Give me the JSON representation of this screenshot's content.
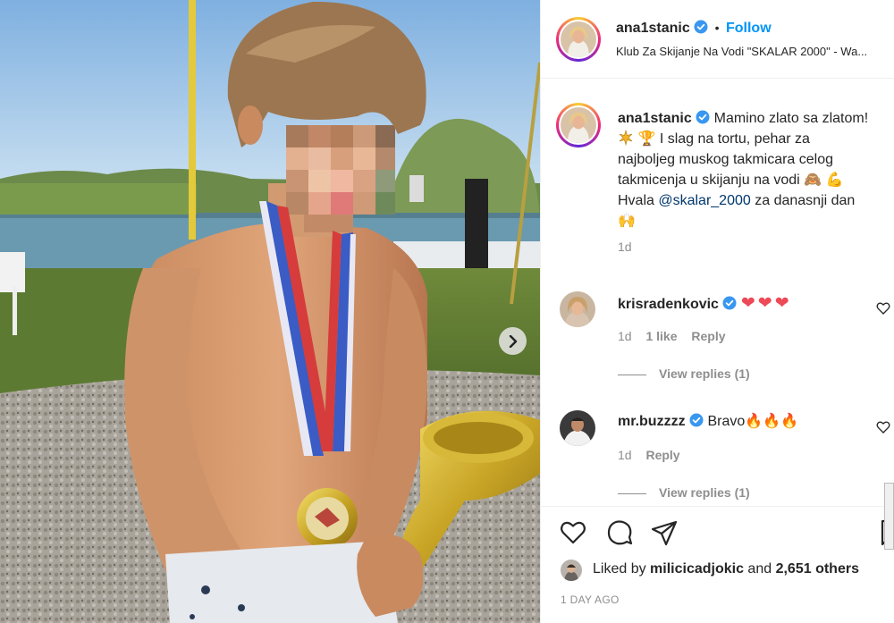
{
  "post": {
    "username": "ana1stanic",
    "follow_label": "Follow",
    "separator": "•",
    "location": "Klub Za Skijanje Na Vodi \"SKALAR 2000\" - Wa...",
    "caption_line1": "Mamino zlato sa zlatom!",
    "caption_line2": "I slag na tortu, pehar za",
    "caption_line3": "najboljeg muskog takmicara celog",
    "caption_line4": "takmicenja u skijanju na vodi",
    "caption_line5_prefix": "Hvala ",
    "caption_mention": "@skalar_2000",
    "caption_line5_suffix": " za danasnji dan",
    "caption_time": "1d",
    "emoji_trophy": "🏆",
    "emoji_monkey": "🙈",
    "emoji_muscle": "💪",
    "emoji_pray": "🙌"
  },
  "comments": [
    {
      "username": "krisradenkovic",
      "text": "❤❤❤",
      "time": "1d",
      "likes": "1 like",
      "reply": "Reply",
      "view_replies": "View replies (1)"
    },
    {
      "username": "mr.buzzzz",
      "text": "Bravo",
      "fire": "🔥🔥🔥",
      "time": "1d",
      "reply": "Reply",
      "view_replies": "View replies (1)"
    }
  ],
  "footer": {
    "liked_by_prefix": "Liked by ",
    "liked_by_user": "milicicadjokic",
    "liked_by_and": " and ",
    "liked_by_count": "2,651 others",
    "time_ago": "1 DAY AGO"
  },
  "colors": {
    "accent": "#0095f6",
    "heart": "#ed4956",
    "muted": "#8e8e8e"
  },
  "icons": {
    "like": "heart-outline-icon",
    "comment": "comment-bubble-icon",
    "share": "paper-plane-icon",
    "verified": "verified-badge-icon",
    "next": "chevron-right-icon"
  }
}
